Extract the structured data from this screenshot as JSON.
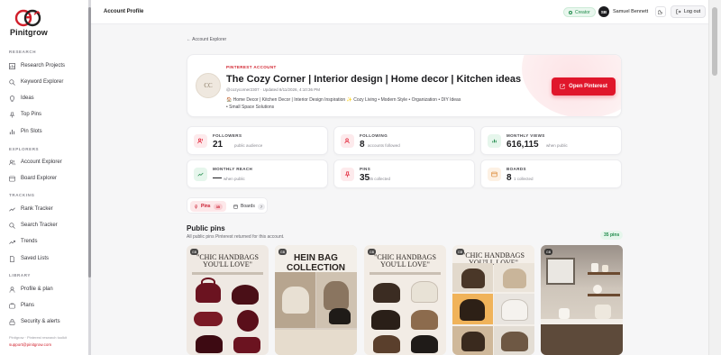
{
  "sidebar": {
    "brand": "Pinitgrow",
    "sections": {
      "research": "RESEARCH",
      "explorers": "EXPLORERS",
      "tracking": "TRACKING",
      "library": "LIBRARY"
    },
    "items": {
      "research_projects": "Research Projects",
      "keyword_explorer": "Keyword Explorer",
      "ideas": "Ideas",
      "top_pins": "Top Pins",
      "pin_slots": "Pin Slots",
      "account_explorer": "Account Explorer",
      "board_explorer": "Board Explorer",
      "rank_tracker": "Rank Tracker",
      "search_tracker": "Search Tracker",
      "trends": "Trends",
      "saved_lists": "Saved Lists",
      "profile_plan": "Profile & plan",
      "plans": "Plans",
      "security_alerts": "Security & alerts"
    },
    "footer_note": "Pinitgrow · Pinterest research toolkit",
    "support_email": "support@pinitgrow.com"
  },
  "topbar": {
    "title": "Account Profile",
    "creator_badge": "Creator",
    "avatar_initials": "SB",
    "user_name": "Samuel Bennett",
    "logout_label": "Log out"
  },
  "main": {
    "back_link": "← Account Explorer",
    "hero": {
      "tag": "PINTEREST ACCOUNT",
      "title": "The Cozy Corner | Interior design | Home decor | Kitchen ideas",
      "meta": "@cozycorner2307 · Updated 8/11/2026, 4:10:36 PM",
      "desc_line1": "🏠 Home Decor | Kitchen Decor | Interior Design Inspiration ✨ Cozy Living • Modern Style • Organization • DIY Ideas",
      "desc_line2": "• Small Space Solutions",
      "avatar_text": "CC",
      "open_button": "Open Pinterest"
    },
    "stats": [
      {
        "label": "FOLLOWERS",
        "value": "21",
        "sub": "public audience",
        "color": "#e0162b",
        "bg": "#fdeaec"
      },
      {
        "label": "FOLLOWING",
        "value": "8",
        "sub": "accounts followed",
        "color": "#e0162b",
        "bg": "#fdeaec"
      },
      {
        "label": "MONTHLY VIEWS",
        "value": "616,115",
        "sub": "when public",
        "color": "#1e8a4a",
        "bg": "#e6f6ec"
      },
      {
        "label": "MONTHLY REACH",
        "value": "—",
        "sub": "when public",
        "color": "#1e8a4a",
        "bg": "#e6f6ec"
      },
      {
        "label": "PINS",
        "value": "35",
        "sub": "35 collected",
        "color": "#e0162b",
        "bg": "#fdeaec"
      },
      {
        "label": "BOARDS",
        "value": "8",
        "sub": "1 collected",
        "color": "#d9822b",
        "bg": "#fdf1e4"
      }
    ],
    "tabs": {
      "pins_label": "Pins",
      "pins_count": "35",
      "boards_label": "Boards",
      "boards_count": "7"
    },
    "pins_section": {
      "heading": "Public pins",
      "subtitle": "All public pins Pinterest returned for this account.",
      "count_badge": "35 pins"
    },
    "pins": [
      {
        "badge": "GB",
        "headline": "\"CHIC HANDBAGS YOU'LL LOVE\""
      },
      {
        "badge": "GB",
        "headline": "HEIN BAG COLLECTION"
      },
      {
        "badge": "GB",
        "headline": "\"CHIC HANDBAGS YOU'LL LOVE\""
      },
      {
        "badge": "GB",
        "headline": "\"CHIC HANDBAGS YOU'LL LOVE\""
      },
      {
        "badge": "GB",
        "headline": ""
      }
    ]
  }
}
